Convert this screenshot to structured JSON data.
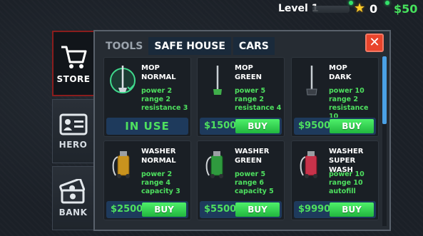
{
  "hud": {
    "level_label": "Level 1",
    "stars": "0",
    "cash": "$50"
  },
  "sidebar": [
    {
      "label": "STORE",
      "icon": "cart-icon"
    },
    {
      "label": "HERO",
      "icon": "id-card-icon"
    },
    {
      "label": "BANK",
      "icon": "money-icon"
    }
  ],
  "tabs": [
    "TOOLS",
    "SAFE HOUSE",
    "CARS"
  ],
  "close_label": "✕",
  "items": [
    {
      "name": "MOP\nNORMAL",
      "stats": [
        "power 2",
        "range 2",
        "resistance 3"
      ],
      "status": "IN USE"
    },
    {
      "name": "MOP\nGREEN",
      "stats": [
        "power 5",
        "range 2",
        "resistance 4"
      ],
      "price": "$1500",
      "buy": "BUY"
    },
    {
      "name": "MOP\nDARK",
      "stats": [
        "power 10",
        "range 2",
        "resistance 10"
      ],
      "price": "$9500",
      "buy": "BUY"
    },
    {
      "name": "WASHER\nNORMAL",
      "stats": [
        "power 2",
        "range 4",
        "capacity 3"
      ],
      "price": "$2500",
      "buy": "BUY"
    },
    {
      "name": "WASHER\nGREEN",
      "stats": [
        "power 5",
        "range 6",
        "capacity 5"
      ],
      "price": "$5500",
      "buy": "BUY"
    },
    {
      "name": "WASHER\nSUPER WASH",
      "stats": [
        "power 10",
        "range 10",
        "autofill"
      ],
      "price": "$9990",
      "buy": "BUY"
    }
  ]
}
